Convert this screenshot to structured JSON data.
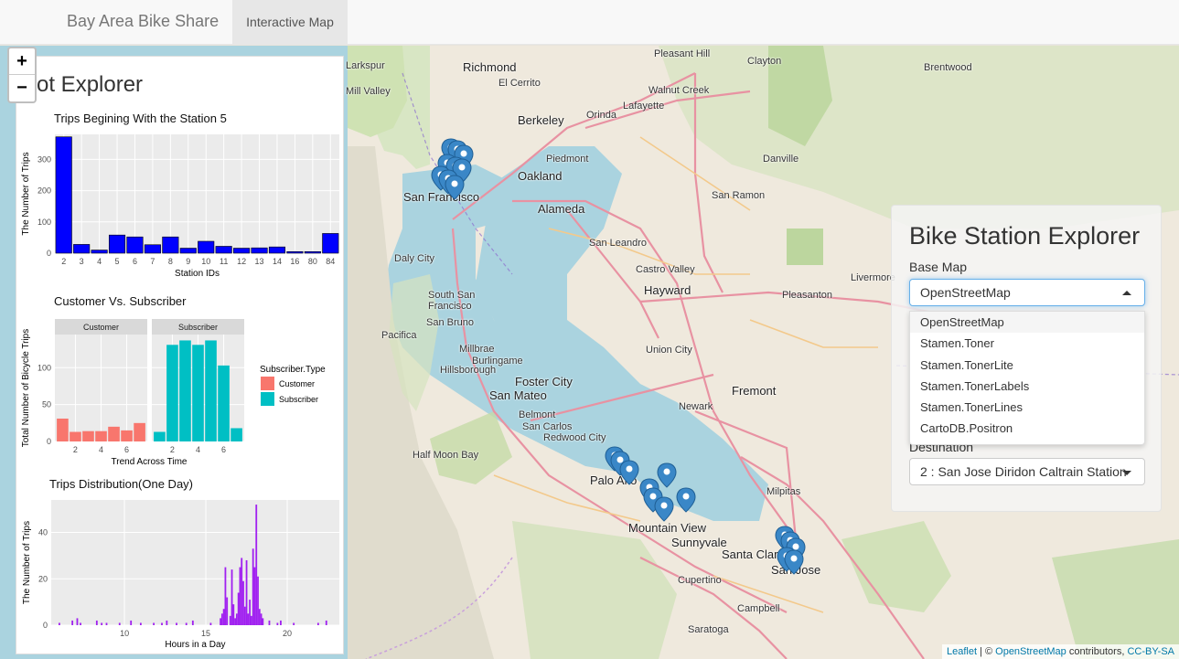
{
  "navbar": {
    "brand": "Bay Area Bike Share",
    "tab": "Interactive Map"
  },
  "zoom": {
    "in": "+",
    "out": "−"
  },
  "left_panel": {
    "title": "ot Explorer",
    "chart1": {
      "title": "Trips Begining With the Station 5",
      "xlabel": "Station IDs",
      "ylabel": "The Number of Trips"
    },
    "chart2": {
      "title": "Customer Vs. Subscriber",
      "xlabel": "Trend Across Time",
      "ylabel": "Total Number of Bicycle Trips",
      "facet1": "Customer",
      "facet2": "Subscriber",
      "legend_title": "Subscriber.Type",
      "legend1": "Customer",
      "legend2": "Subscriber"
    },
    "chart3": {
      "title": "Trips Distribution(One Day)",
      "xlabel": "Hours in a Day",
      "ylabel": "The Number of Trips"
    }
  },
  "right_panel": {
    "title": "Bike Station Explorer",
    "base_map_label": "Base Map",
    "base_map_value": "OpenStreetMap",
    "options": [
      "OpenStreetMap",
      "Stamen.Toner",
      "Stamen.TonerLite",
      "Stamen.TonerLabels",
      "Stamen.TonerLines",
      "CartoDB.Positron"
    ],
    "destination_label": "Destination",
    "destination_value": "2 : San Jose Diridon Caltrain Station"
  },
  "attribution": {
    "leaflet": "Leaflet",
    "osm": "OpenStreetMap",
    "text": " contributors, ",
    "license": "CC-BY-SA"
  },
  "map_labels": [
    "Richmond",
    "El Cerrito",
    "Berkeley",
    "Oakland",
    "Alameda",
    "San Leandro",
    "Hayward",
    "Castro Valley",
    "San Ramon",
    "Pleasanton",
    "Livermore",
    "Union City",
    "Fremont",
    "Newark",
    "San Francisco",
    "Daly City",
    "South San Francisco",
    "San Bruno",
    "Pacifica",
    "Millbrae",
    "Burlingame",
    "Hillsborough",
    "Foster City",
    "San Mateo",
    "Belmont",
    "San Carlos",
    "Redwood City",
    "Half Moon Bay",
    "Palo Alto",
    "Mountain View",
    "Sunnyvale",
    "Santa Clara",
    "San Jose",
    "Milpitas",
    "Cupertino",
    "Campbell",
    "Saratoga",
    "Pleasant Hill",
    "Clayton",
    "Walnut Creek",
    "Lafayette",
    "Orinda",
    "Piedmont",
    "Brentwood",
    "Larkspur",
    "Mill Valley",
    "Danville"
  ],
  "chart_data": [
    {
      "type": "bar",
      "title": "Trips Begining With the Station 5",
      "xlabel": "Station IDs",
      "ylabel": "The Number of Trips",
      "categories": [
        "2",
        "3",
        "4",
        "5",
        "6",
        "7",
        "8",
        "9",
        "10",
        "11",
        "12",
        "13",
        "14",
        "16",
        "80",
        "84"
      ],
      "tick_labels": [
        "2",
        "3",
        "4",
        "5",
        "6",
        "7",
        "8",
        "9",
        "10",
        "11",
        "12",
        "13",
        "14",
        "16",
        "80",
        "84"
      ],
      "values": [
        372,
        28,
        10,
        58,
        52,
        27,
        52,
        16,
        38,
        22,
        16,
        17,
        20,
        5,
        5,
        63
      ],
      "ylim": [
        0,
        380
      ],
      "yticks": [
        0,
        100,
        200,
        300
      ],
      "color": "#0000ff"
    },
    {
      "type": "bar",
      "title": "Customer Vs. Subscriber",
      "xlabel": "Trend Across Time",
      "ylabel": "Total Number of Bicycle Trips",
      "facets": [
        "Customer",
        "Subscriber"
      ],
      "x": [
        1,
        2,
        3,
        4,
        5,
        6,
        7
      ],
      "xticks": [
        2,
        4,
        6
      ],
      "series": [
        {
          "name": "Customer",
          "color": "#f8766d",
          "values": [
            31,
            13,
            14,
            14,
            20,
            15,
            25
          ]
        },
        {
          "name": "Subscriber",
          "color": "#00bfc4",
          "values": [
            13,
            131,
            137,
            131,
            137,
            103,
            18
          ]
        }
      ],
      "ylim": [
        0,
        145
      ],
      "yticks": [
        0,
        50,
        100
      ],
      "legend_title": "Subscriber.Type"
    },
    {
      "type": "bar",
      "title": "Trips Distribution(One Day)",
      "xlabel": "Hours in a Day",
      "ylabel": "The Number of Trips",
      "x": [
        6.0,
        6.8,
        7.1,
        7.3,
        8.3,
        8.6,
        8.9,
        9.7,
        10.4,
        11.0,
        11.8,
        12.3,
        12.6,
        13.2,
        13.8,
        14.2,
        15.3,
        15.9,
        16.0,
        16.1,
        16.2,
        16.3,
        16.5,
        16.6,
        16.7,
        16.8,
        16.9,
        17.0,
        17.1,
        17.2,
        17.3,
        17.4,
        17.5,
        17.6,
        17.7,
        17.8,
        17.9,
        18.0,
        18.1,
        18.2,
        18.3,
        18.4,
        18.5,
        18.9,
        19.4,
        19.6,
        20.4,
        21.9,
        22.4
      ],
      "values": [
        1,
        2,
        3,
        1,
        2,
        1,
        1,
        1,
        2,
        1,
        1,
        1,
        2,
        1,
        1,
        2,
        1,
        3,
        5,
        7,
        25,
        12,
        4,
        24,
        9,
        3,
        5,
        14,
        25,
        29,
        19,
        8,
        28,
        5,
        11,
        4,
        33,
        25,
        52,
        21,
        7,
        5,
        3,
        2,
        1,
        2,
        1,
        1,
        2
      ],
      "xlim": [
        5.5,
        23.2
      ],
      "xticks": [
        10,
        15,
        20
      ],
      "ylim": [
        0,
        54
      ],
      "yticks": [
        0,
        20,
        40
      ],
      "color": "#a020f0"
    }
  ]
}
